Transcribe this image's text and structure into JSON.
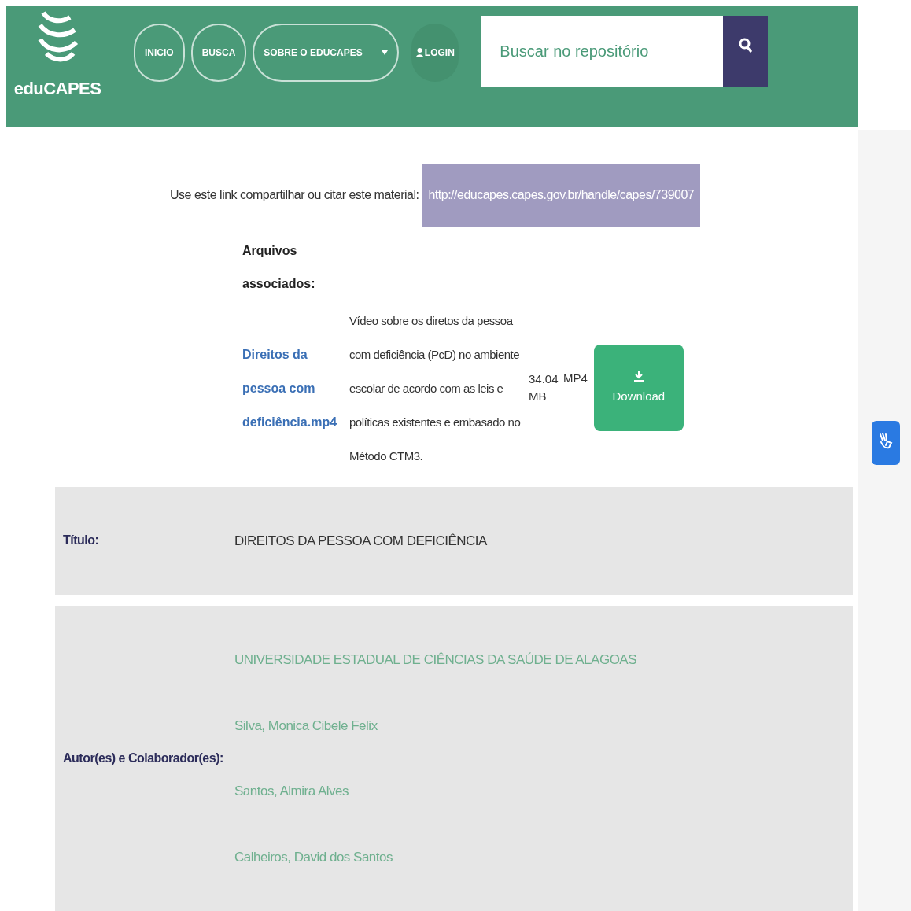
{
  "header": {
    "logo_text": "eduCAPES",
    "nav": [
      {
        "label": "INICIO",
        "kind": "pill"
      },
      {
        "label": "BUSCA",
        "kind": "pill"
      },
      {
        "label": "SOBRE O EDUCAPES",
        "kind": "dropdown"
      },
      {
        "label": "LOGIN",
        "kind": "login"
      }
    ],
    "search": {
      "placeholder": "Buscar no repositório"
    }
  },
  "share": {
    "label": "Use este link compartilhar ou citar este material:",
    "url": "http://educapes.capes.gov.br/handle/capes/739007"
  },
  "files": {
    "heading": "Arquivos associados:",
    "items": [
      {
        "name": "Direitos da pessoa com deficiência.mp4",
        "description": "Vídeo sobre os diretos da pessoa com deficiência (PcD) no ambiente escolar de acordo com as leis e políticas existentes e embasado no Método CTM3.",
        "size": "34.04 MB",
        "format": "MP4",
        "button": "Download"
      }
    ]
  },
  "metadata": [
    {
      "label": "Título:",
      "kind": "plain",
      "values": [
        "DIREITOS DA PESSOA COM DEFICIÊNCIA"
      ]
    },
    {
      "label": "Autor(es) e Colaborador(es):",
      "kind": "links",
      "values": [
        "UNIVERSIDADE ESTADUAL DE CIÊNCIAS DA SAÚDE DE ALAGOAS",
        "Silva, Monica Cibele Felix",
        "Santos, Almira Alves",
        "Calheiros, David dos Santos"
      ]
    }
  ]
}
